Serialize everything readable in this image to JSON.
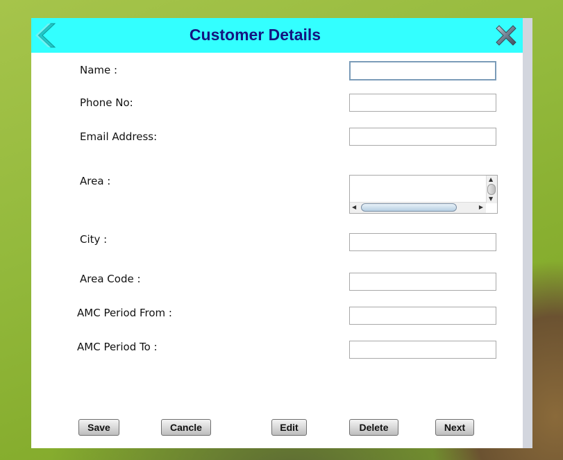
{
  "dialog": {
    "title": "Customer Details",
    "back_icon": "chevron-left-icon",
    "close_icon": "close-x-icon"
  },
  "form": {
    "name_label": "Name :",
    "phone_label": "Phone No:",
    "email_label": "Email Address:",
    "area_label": "Area :",
    "city_label": "City :",
    "area_code_label": "Area Code :",
    "amc_from_label": "AMC Period From :",
    "amc_to_label": "AMC Period To :",
    "name_value": "",
    "phone_value": "",
    "email_value": "",
    "area_value": "",
    "city_value": "",
    "area_code_value": "",
    "amc_from_value": "",
    "amc_to_value": ""
  },
  "buttons": {
    "save": "Save",
    "cancel": "Cancle",
    "edit": "Edit",
    "delete": "Delete",
    "next": "Next"
  },
  "colors": {
    "titlebar": "#33ffff",
    "title_text": "#141480"
  }
}
